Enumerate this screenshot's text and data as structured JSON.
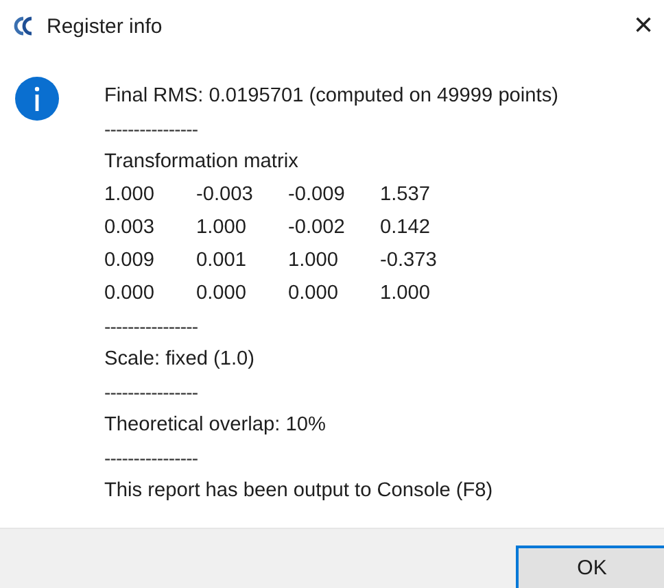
{
  "window": {
    "title": "Register info",
    "close": "×"
  },
  "message": [
    {
      "kind": "text",
      "text": "Final RMS: 0.0195701 (computed on 49999 points)"
    },
    {
      "kind": "separator",
      "text": "----------------"
    },
    {
      "kind": "text",
      "text": "Transformation matrix"
    },
    {
      "kind": "matrix",
      "rows": [
        [
          "1.000",
          "-0.003",
          "-0.009",
          "1.537"
        ],
        [
          "0.003",
          "1.000",
          "-0.002",
          "0.142"
        ],
        [
          "0.009",
          "0.001",
          "1.000",
          "-0.373"
        ],
        [
          "0.000",
          "0.000",
          "0.000",
          "1.000"
        ]
      ]
    },
    {
      "kind": "separator",
      "text": "----------------"
    },
    {
      "kind": "text",
      "text": "Scale: fixed (1.0)"
    },
    {
      "kind": "separator",
      "text": "----------------"
    },
    {
      "kind": "text",
      "text": "Theoretical overlap: 10%"
    },
    {
      "kind": "separator",
      "text": "----------------"
    },
    {
      "kind": "text",
      "text": "This report has been output to Console (F8)"
    }
  ],
  "buttons": [
    {
      "label": "OK",
      "selected": true
    }
  ]
}
